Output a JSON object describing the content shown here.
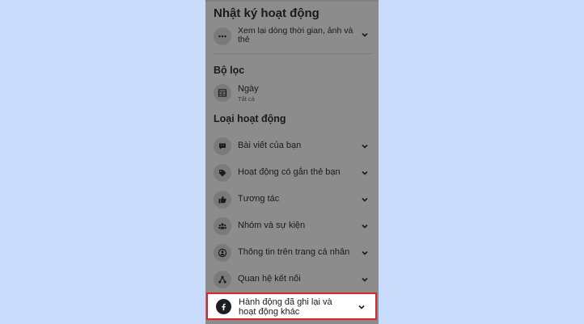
{
  "header": {
    "title": "Nhật ký hoạt động",
    "review_label": "Xem lại dòng thời gian, ảnh và thẻ"
  },
  "filter": {
    "section_title": "Bộ lọc",
    "date_label": "Ngày",
    "date_value": "Tất cả"
  },
  "activity": {
    "section_title": "Loại hoạt động",
    "items": [
      {
        "label": "Bài viết của bạn",
        "icon": "chat-bubble-icon"
      },
      {
        "label": "Hoạt động có gắn thẻ bạn",
        "icon": "tag-icon"
      },
      {
        "label": "Tương tác",
        "icon": "thumbs-up-icon"
      },
      {
        "label": "Nhóm và sự kiện",
        "icon": "people-icon"
      },
      {
        "label": "Thông tin trên trang cá nhân",
        "icon": "user-circle-icon"
      },
      {
        "label": "Quan hệ kết nối",
        "icon": "network-icon"
      }
    ],
    "highlighted": {
      "label": "Hành động đã ghi lại và hoạt động khác",
      "icon": "facebook-icon"
    }
  },
  "colors": {
    "highlight_border": "#d9262e",
    "background": "#c9dcfb",
    "overlay": "#8c8c8c"
  }
}
